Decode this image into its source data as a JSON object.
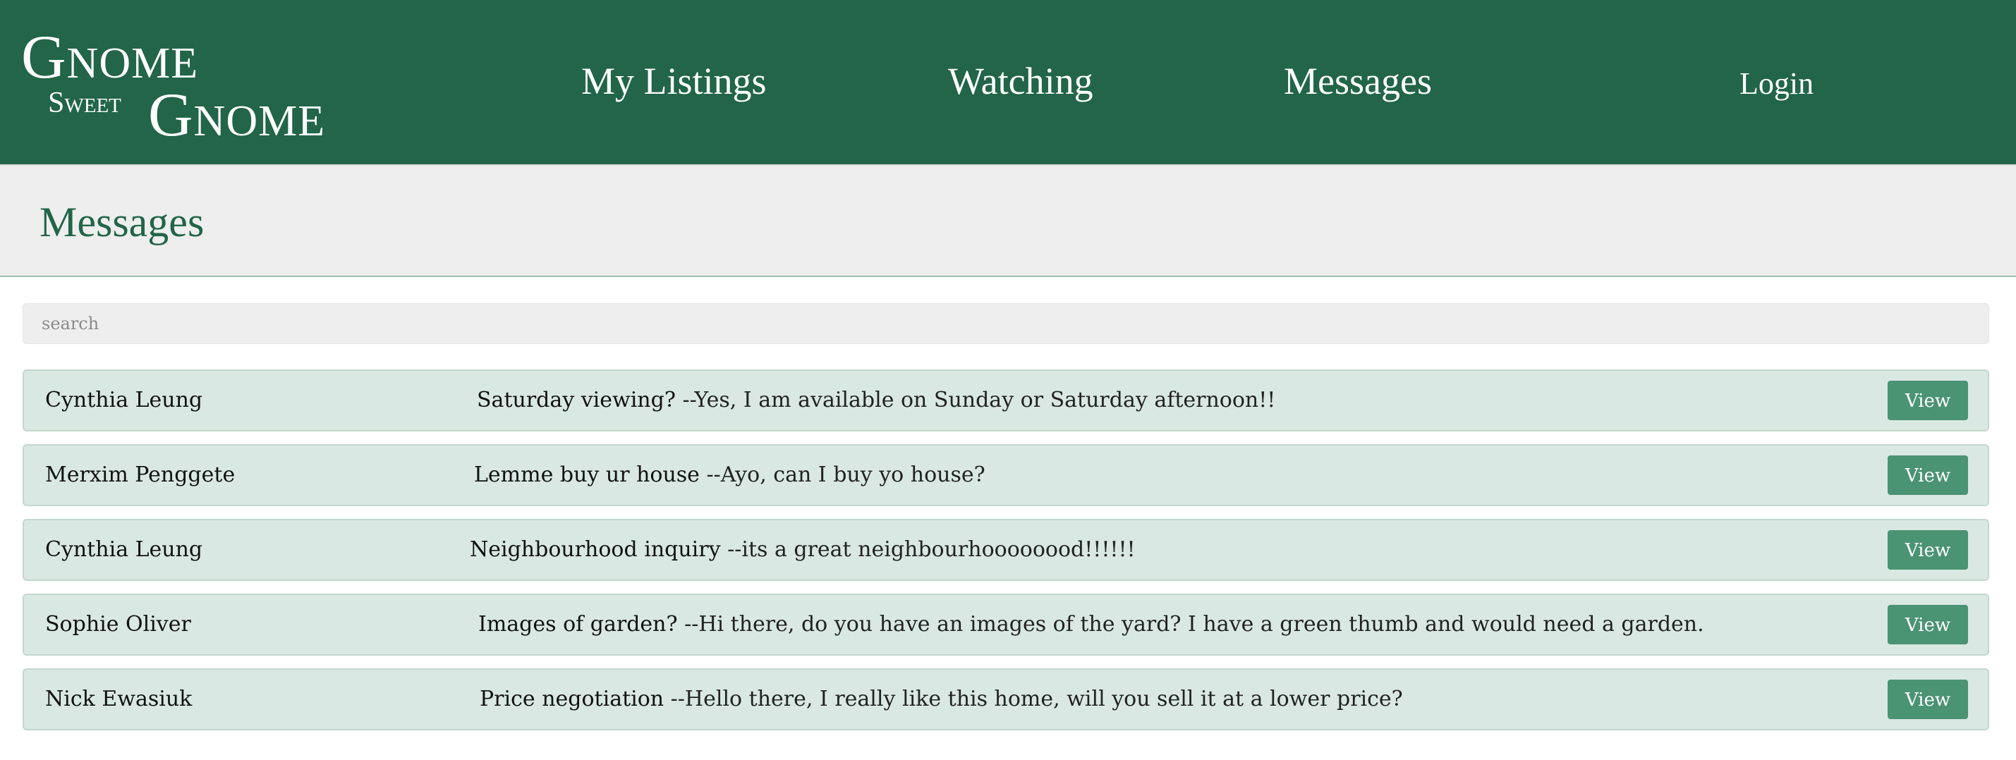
{
  "brand": {
    "line1": "Gnome",
    "line2": "Sweet",
    "line3": "Gnome"
  },
  "nav": {
    "my_listings": "My Listings",
    "watching": "Watching",
    "messages": "Messages",
    "login": "Login"
  },
  "page": {
    "title": "Messages"
  },
  "search": {
    "placeholder": "search",
    "value": ""
  },
  "messages": [
    {
      "sender": "Cynthia Leung",
      "subject": "Saturday viewing?",
      "body": " --Yes, I am available on Sunday or Saturday afternoon!!",
      "action": "View"
    },
    {
      "sender": "Merxim Penggete",
      "subject": "Lemme buy ur house",
      "body": " --Ayo, can I buy yo house?",
      "action": "View"
    },
    {
      "sender": "Cynthia Leung",
      "subject": "Neighbourhood inquiry",
      "body": " --its a great neighbourhoooooood!!!!!!",
      "action": "View"
    },
    {
      "sender": "Sophie Oliver",
      "subject": "Images of garden?",
      "body": " --Hi there, do you have an images of the yard? I have a green thumb and would need a garden.",
      "action": "View"
    },
    {
      "sender": "Nick Ewasiuk",
      "subject": "Price negotiation",
      "body": " --Hello there, I really like this home, will you sell it at a lower price?",
      "action": "View"
    }
  ],
  "colors": {
    "header_bg": "#226548",
    "title_band_bg": "#eeeeee",
    "row_bg": "#d9e8e2",
    "button_bg": "#4a9373",
    "title_text": "#226548"
  }
}
